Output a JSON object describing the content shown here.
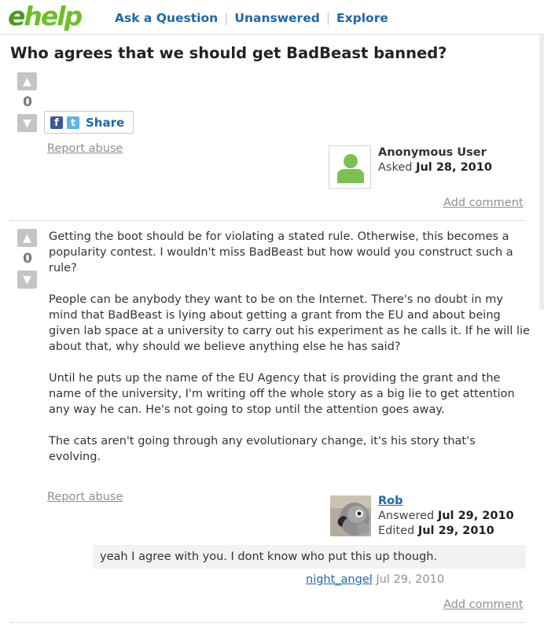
{
  "header": {
    "logo_e": "e",
    "logo_rest": "help",
    "nav": [
      "Ask a Question",
      "Unanswered",
      "Explore"
    ]
  },
  "question": {
    "title": "Who agrees that we should get BadBeast banned?",
    "vote_count": "0",
    "share_label": "Share",
    "report_label": "Report abuse",
    "author": "Anonymous User",
    "asked_prefix": "Asked",
    "asked_date": "Jul 28, 2010",
    "add_comment": "Add comment"
  },
  "answer": {
    "vote_count": "0",
    "paragraphs": [
      "Getting the boot should be for violating a stated rule. Otherwise, this becomes a popularity contest. I wouldn't miss BadBeast but how would you construct such a rule?",
      "People can be anybody they want to be on the Internet. There's no doubt in my mind that BadBeast is lying about getting a grant from the EU and about being given lab space at a university to carry out his experiment as he calls it. If he will lie about that, why should we believe anything else he has said?",
      "Until he puts up the name of the EU Agency that is providing the grant and the name of the university, I'm writing off the whole story as a big lie to get attention any way he can. He's not going to stop until the attention goes away.",
      "The cats aren't going through any evolutionary change, it's his story that's evolving."
    ],
    "report_label": "Report abuse",
    "author": "Rob",
    "answered_prefix": "Answered",
    "answered_date": "Jul 29, 2010",
    "edited_prefix": "Edited",
    "edited_date": "Jul 29, 2010",
    "comment": {
      "text": "yeah I agree with you. I dont know who put this up though.",
      "author": "night_angel",
      "date": "Jul 29, 2010"
    },
    "add_comment": "Add comment"
  },
  "colors": {
    "link": "#1d68a8",
    "logo_green": "#6cc02a",
    "vote_button": "#c4c4c4"
  },
  "icons": [
    "vote-up-icon",
    "vote-down-icon",
    "facebook-icon",
    "twitter-icon",
    "anonymous-avatar-icon",
    "parrot-avatar"
  ]
}
